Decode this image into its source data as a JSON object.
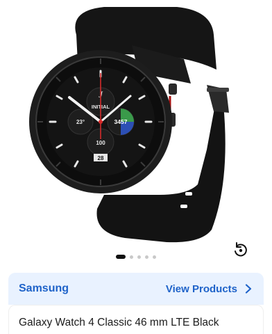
{
  "product": {
    "title": "Galaxy Watch 4 Classic 46 mm LTE Black",
    "image_alt": "Galaxy Watch 4 Classic black"
  },
  "brand": {
    "name": "Samsung",
    "link_label": "View Products"
  },
  "gallery": {
    "slide_count": 5,
    "active_index": 0
  },
  "watch_face": {
    "initial_label": "INITIAL",
    "temperature": "23°",
    "steps": "3457",
    "percent": "100",
    "date": "28"
  },
  "colors": {
    "accent": "#1f63c9",
    "brand_bar_bg": "#e9f2ff",
    "watch_black": "#111111"
  }
}
